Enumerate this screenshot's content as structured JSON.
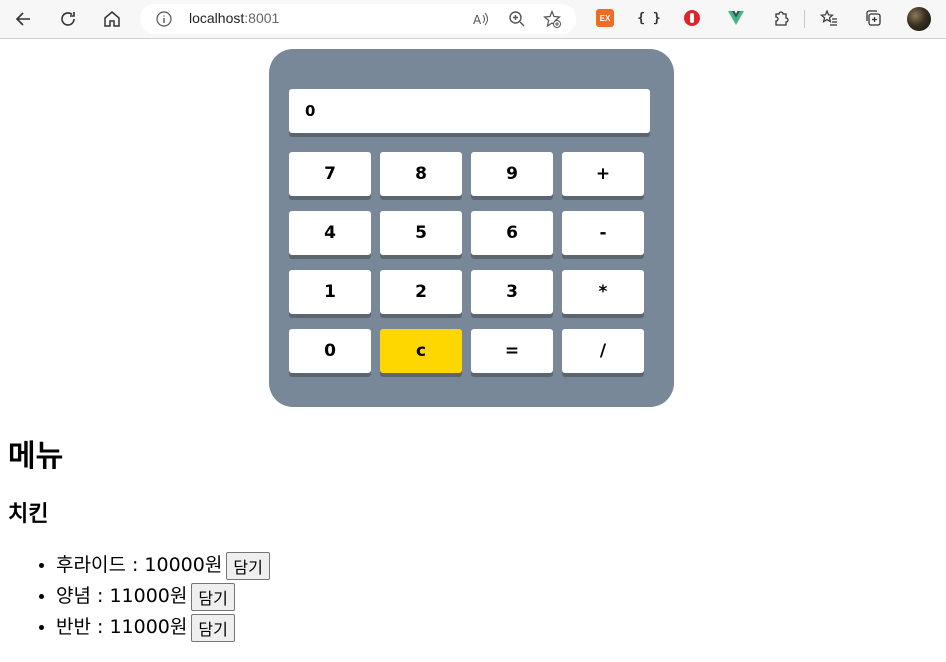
{
  "browser": {
    "url_host": "localhost",
    "url_port": ":8001"
  },
  "calculator": {
    "display": "0",
    "keys": [
      {
        "label": "7",
        "type": "digit"
      },
      {
        "label": "8",
        "type": "digit"
      },
      {
        "label": "9",
        "type": "digit"
      },
      {
        "label": "+",
        "type": "operator"
      },
      {
        "label": "4",
        "type": "digit"
      },
      {
        "label": "5",
        "type": "digit"
      },
      {
        "label": "6",
        "type": "digit"
      },
      {
        "label": "-",
        "type": "operator"
      },
      {
        "label": "1",
        "type": "digit"
      },
      {
        "label": "2",
        "type": "digit"
      },
      {
        "label": "3",
        "type": "digit"
      },
      {
        "label": "*",
        "type": "operator"
      },
      {
        "label": "0",
        "type": "digit"
      },
      {
        "label": "c",
        "type": "clear"
      },
      {
        "label": "=",
        "type": "equals"
      },
      {
        "label": "/",
        "type": "operator"
      }
    ],
    "colors": {
      "body": "#798899",
      "key": "#ffffff",
      "clear_key": "#ffd700"
    }
  },
  "menu": {
    "title": "메뉴",
    "category": "치킨",
    "items": [
      {
        "name": "후라이드",
        "separator": " : ",
        "price": "10000원",
        "button": "담기"
      },
      {
        "name": "양념",
        "separator": " : ",
        "price": "11000원",
        "button": "담기"
      },
      {
        "name": "반반",
        "separator": " : ",
        "price": "11000원",
        "button": "담기"
      }
    ]
  }
}
